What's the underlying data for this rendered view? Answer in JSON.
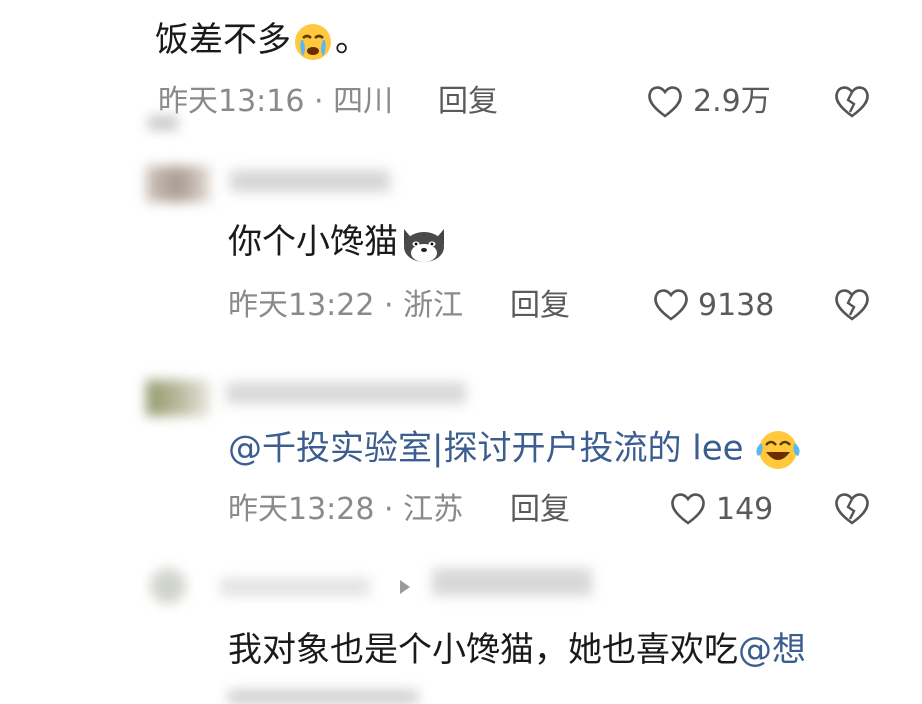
{
  "comments": [
    {
      "text": "饭差不多",
      "trailing": "。",
      "emoji": "crying-face-emoji",
      "time": "昨天13:16",
      "sep": " · ",
      "location": "四川",
      "reply_label": "回复",
      "likes": "2.9万"
    },
    {
      "text": "你个小馋猫",
      "emoji": "husky-dog-emoji",
      "time": "昨天13:22",
      "sep": " · ",
      "location": "浙江",
      "reply_label": "回复",
      "likes": "9138"
    },
    {
      "mention": "@千投实验室|探讨开户投流的 lee",
      "emoji": "joy-tears-emoji",
      "time": "昨天13:28",
      "sep": " · ",
      "location": "江苏",
      "reply_label": "回复",
      "likes": "149"
    },
    {
      "text": "我对象也是个小馋猫，她也喜欢吃",
      "mention": "@想"
    }
  ],
  "colors": {
    "text": "#1a1a1a",
    "meta": "#8a8a8a",
    "mention": "#3b5d8f"
  }
}
